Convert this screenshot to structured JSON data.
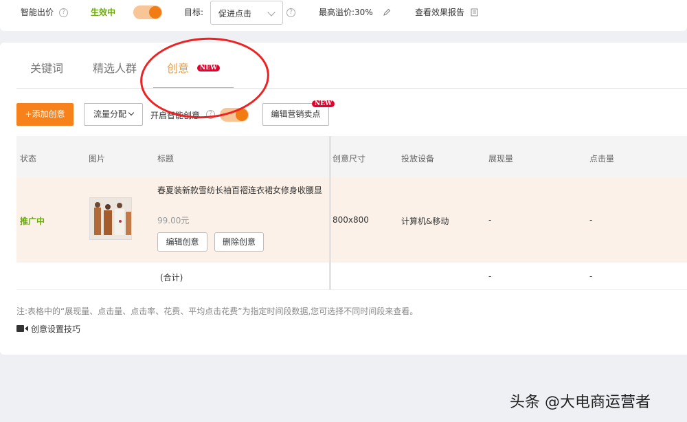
{
  "topbar": {
    "smart_bid_label": "智能出价",
    "status_label": "生效中",
    "target_label": "目标:",
    "target_value": "促进点击",
    "max_premium": "最高溢价:30%",
    "view_report": "查看效果报告"
  },
  "tabs": [
    {
      "label": "关键词",
      "active": false
    },
    {
      "label": "精选人群",
      "active": false
    },
    {
      "label": "创意",
      "active": true,
      "badge": "NEW"
    }
  ],
  "toolbar": {
    "add_button": "+添加创意",
    "traffic_dist": "流量分配",
    "smart_creative": "开启智能创意",
    "edit_selling_points": "编辑营销卖点",
    "edit_badge": "NEW"
  },
  "table": {
    "headers": [
      "状态",
      "图片",
      "标题",
      "创意尺寸",
      "投放设备",
      "展现量",
      "点击量"
    ],
    "row": {
      "status": "推广中",
      "title": "春夏装新款雪纺长袖百褶连衣裙女修身收腰显",
      "price": "99.00元",
      "edit_button": "编辑创意",
      "delete_button": "删除创意",
      "size": "800x800",
      "device": "计算机&移动",
      "impressions": "-",
      "clicks": "-"
    },
    "total": {
      "label": "(合计)",
      "impressions": "-",
      "clicks": "-"
    }
  },
  "note": "注:表格中的“展现量、点击量、点击率、花费、平均点击花费”为指定时间段数据,您可选择不同时间段来查看。",
  "tip": "创意设置技巧",
  "watermark": "头条 @大电商运营者",
  "colors": {
    "accent": "#f7811a",
    "status_green": "#6aa90a",
    "new_badge": "#e6002d",
    "annotation": "#e22222"
  }
}
